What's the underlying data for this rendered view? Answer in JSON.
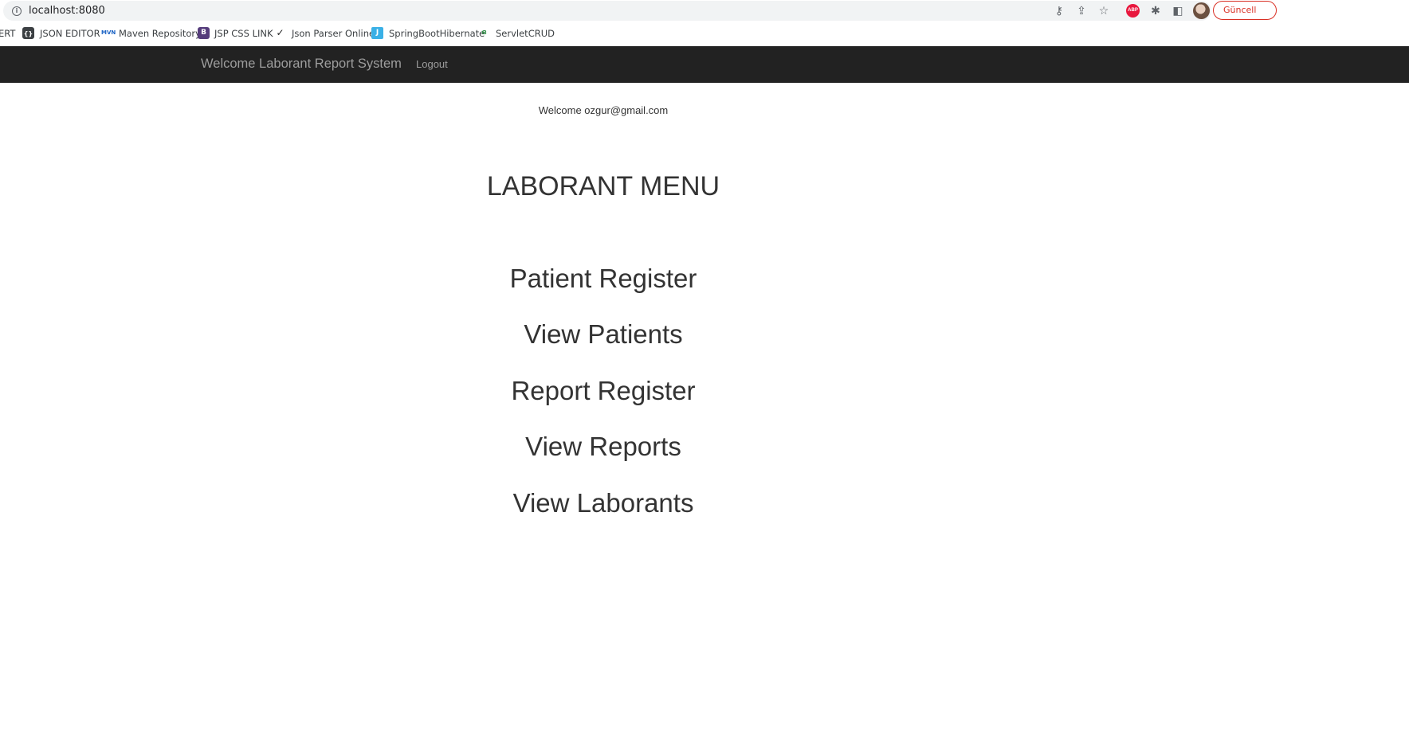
{
  "browser": {
    "url": "localhost:8080",
    "update_label": "Güncell"
  },
  "bookmarks": [
    {
      "label": "ERT",
      "icon": "none"
    },
    {
      "label": "JSON EDITOR",
      "icon": "json-editor-icon"
    },
    {
      "label": "Maven Repository",
      "icon": "maven-icon"
    },
    {
      "label": "JSP CSS LINK",
      "icon": "bootstrap-icon"
    },
    {
      "label": "Json Parser Online",
      "icon": "json-parser-icon"
    },
    {
      "label": "SpringBootHibernate",
      "icon": "javatpoint-icon"
    },
    {
      "label": "ServletCRUD",
      "icon": "geeks-icon"
    }
  ],
  "navbar": {
    "brand": "Welcome Laborant Report System",
    "logout": "Logout"
  },
  "main": {
    "welcome": "Welcome ozgur@gmail.com",
    "title": "LABORANT MENU",
    "links": [
      "Patient Register",
      "View Patients",
      "Report Register",
      "View Reports",
      "View Laborants"
    ]
  }
}
